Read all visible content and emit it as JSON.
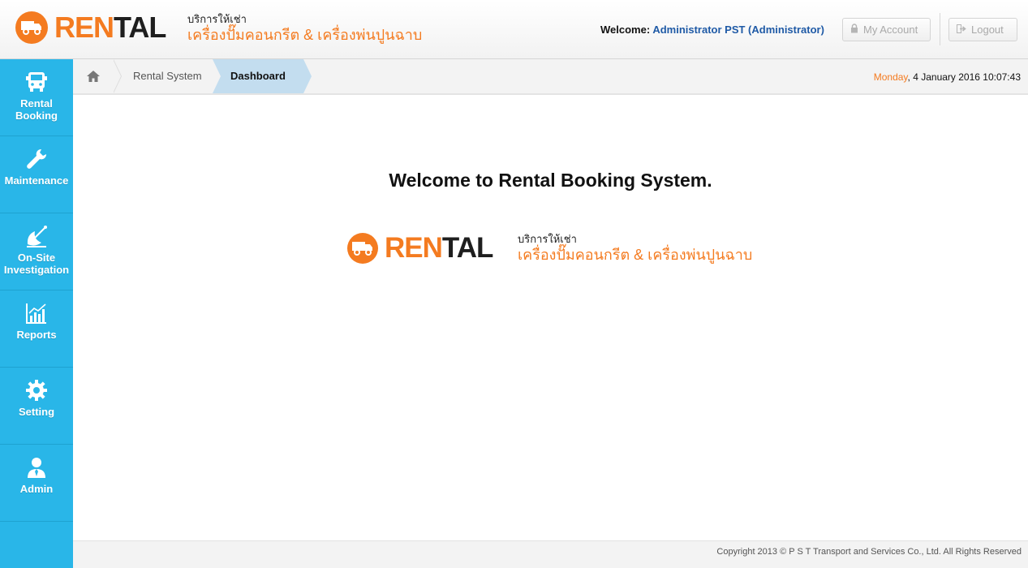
{
  "header": {
    "logo_ren": "REN",
    "logo_tal": "TAL",
    "tagline_small": "บริการให้เช่า",
    "tagline_big": "เครื่องปั๊มคอนกรีต & เครื่องพ่นปูนฉาบ",
    "welcome_label": "Welcome:",
    "welcome_user": "Administrator PST (Administrator)",
    "my_account": "My Account",
    "logout": "Logout"
  },
  "sidebar": {
    "items": [
      {
        "label_line1": "Rental",
        "label_line2": "Booking",
        "icon": "bus-icon"
      },
      {
        "label_line1": "Maintenance",
        "label_line2": "",
        "icon": "wrench-icon"
      },
      {
        "label_line1": "On-Site",
        "label_line2": "Investigation",
        "icon": "satellite-dish-icon"
      },
      {
        "label_line1": "Reports",
        "label_line2": "",
        "icon": "chart-icon"
      },
      {
        "label_line1": "Setting",
        "label_line2": "",
        "icon": "gear-icon"
      },
      {
        "label_line1": "Admin",
        "label_line2": "",
        "icon": "user-icon"
      }
    ]
  },
  "breadcrumb": {
    "items": [
      "Rental System",
      "Dashboard"
    ]
  },
  "datetime": {
    "day": "Monday",
    "rest": ", 4 January 2016 10:07:43"
  },
  "main": {
    "title": "Welcome to Rental Booking System."
  },
  "footer": {
    "copyright": "Copyright 2013 © P S T Transport and Services Co., Ltd. All Rights Reserved"
  },
  "colors": {
    "brand_orange": "#f47b20",
    "sidebar_blue": "#29b6e8",
    "breadcrumb_active": "#c3ddef",
    "user_link": "#1f5aa6"
  }
}
